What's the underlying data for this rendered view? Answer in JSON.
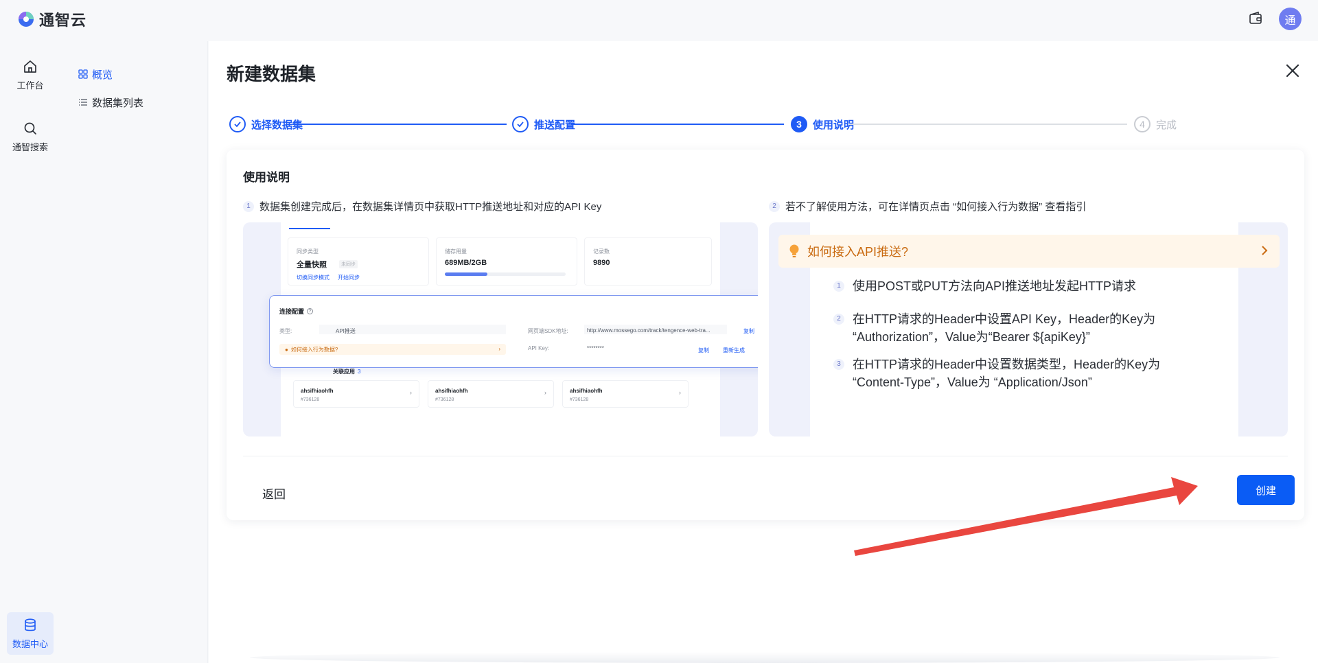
{
  "app": {
    "name": "通智云",
    "avatar_text": "通"
  },
  "rail": {
    "items": [
      {
        "label": "工作台",
        "icon": "home-icon"
      },
      {
        "label": "通智搜索",
        "icon": "search-icon"
      },
      {
        "label": "数据中心",
        "icon": "database-icon",
        "active": true
      }
    ]
  },
  "subnav": {
    "items": [
      {
        "label": "概览",
        "icon": "grid-icon",
        "active": true
      },
      {
        "label": "数据集列表",
        "icon": "list-icon"
      }
    ]
  },
  "page": {
    "title": "新建数据集"
  },
  "steps": [
    {
      "label": "选择数据集",
      "status": "done"
    },
    {
      "label": "推送配置",
      "status": "done"
    },
    {
      "num": "3",
      "label": "使用说明",
      "status": "current"
    },
    {
      "num": "4",
      "label": "完成",
      "status": "todo"
    }
  ],
  "card": {
    "title": "使用说明",
    "tip1": {
      "num": "1",
      "text": "数据集创建完成后，在数据集详情页中获取HTTP推送地址和对应的API Key"
    },
    "tip2": {
      "num": "2",
      "text": "若不了解使用方法，可在详情页点击 “如何接入行为数据” 查看指引"
    }
  },
  "preview_left": {
    "sync": {
      "label": "同步类型",
      "value": "全量快照",
      "tag": "未同步",
      "link1": "切换同步模式",
      "link2": "开始同步"
    },
    "storage": {
      "label": "储存用量",
      "value": "689MB/2GB",
      "fraction": 0.35
    },
    "records": {
      "label": "记录数",
      "value": "9890"
    },
    "conn": {
      "title": "连接配置",
      "type_label": "类型:",
      "type_value": "API推送",
      "sdk_label": "网页端SDK地址:",
      "sdk_value": "http://www.mossego.com/track/tengence-web-tra...",
      "copy1": "复制",
      "apikey_label": "API Key:",
      "apikey_value": "********",
      "copy2": "复制",
      "regen": "重新生成",
      "hint": "如何接入行为数据?"
    },
    "related": {
      "title": "关联应用",
      "count": "3",
      "apps": [
        {
          "name": "ahsifhiaohfh",
          "id": "#736128"
        },
        {
          "name": "ahsifhiaohfh",
          "id": "#736128"
        },
        {
          "name": "ahsifhiaohfh",
          "id": "#736128"
        }
      ]
    }
  },
  "preview_right": {
    "banner": "如何接入API推送?",
    "rules": [
      {
        "num": "1",
        "line1": "使用POST或PUT方法向API推送地址发起HTTP请求",
        "line2": ""
      },
      {
        "num": "2",
        "line1": "在HTTP请求的Header中设置API Key，Header的Key为",
        "line2": "“Authorization”，Value为“Bearer ${apiKey}”"
      },
      {
        "num": "3",
        "line1": "在HTTP请求的Header中设置数据类型，Header的Key为",
        "line2": "“Content-Type”，Value为 “Application/Json”"
      }
    ]
  },
  "actions": {
    "back": "返回",
    "create": "创建"
  },
  "colors": {
    "primary": "#0a5cf5",
    "accent": "#1f5bf5",
    "warning_text": "#c96a10",
    "warning_bg": "#fff6ea",
    "annotation": "#e9463f"
  }
}
